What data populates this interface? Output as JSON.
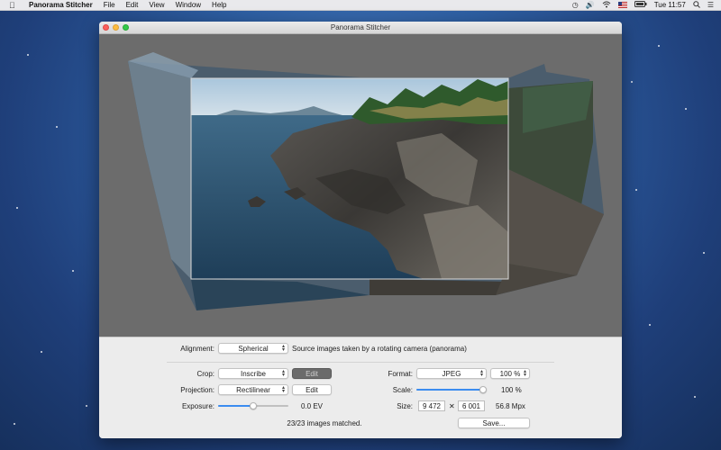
{
  "menubar": {
    "apple_icon": "apple-icon",
    "app_name": "Panorama Stitcher",
    "menus": [
      "File",
      "Edit",
      "View",
      "Window",
      "Help"
    ],
    "status_icons": [
      "time-machine-icon",
      "volume-icon",
      "wifi-icon",
      "flag-icon",
      "battery-icon"
    ],
    "clock": "Tue 11:57",
    "search_icon": "search-icon",
    "list_icon": "list-icon"
  },
  "window": {
    "title": "Panorama Stitcher"
  },
  "controls": {
    "alignment_label": "Alignment:",
    "alignment_value": "Spherical",
    "alignment_desc": "Source images taken by a rotating camera (panorama)",
    "crop_label": "Crop:",
    "crop_value": "Inscribe",
    "crop_edit": "Edit",
    "projection_label": "Projection:",
    "projection_value": "Rectilinear",
    "projection_edit": "Edit",
    "exposure_label": "Exposure:",
    "exposure_value": "0.0 EV",
    "exposure_fraction": 0.5,
    "format_label": "Format:",
    "format_value": "JPEG",
    "quality_value": "100 %",
    "scale_label": "Scale:",
    "scale_value": "100 %",
    "scale_fraction": 1.0,
    "size_label": "Size:",
    "size_width": "9 472",
    "size_height": "6 001",
    "size_times": "✕",
    "size_mpx": "56.8 Mpx",
    "save_button": "Save...",
    "status": "23/23 images matched."
  },
  "colors": {
    "accent": "#3b8cf0",
    "close": "#fc605c",
    "minimize": "#fdbc40",
    "maximize": "#34c84a"
  }
}
